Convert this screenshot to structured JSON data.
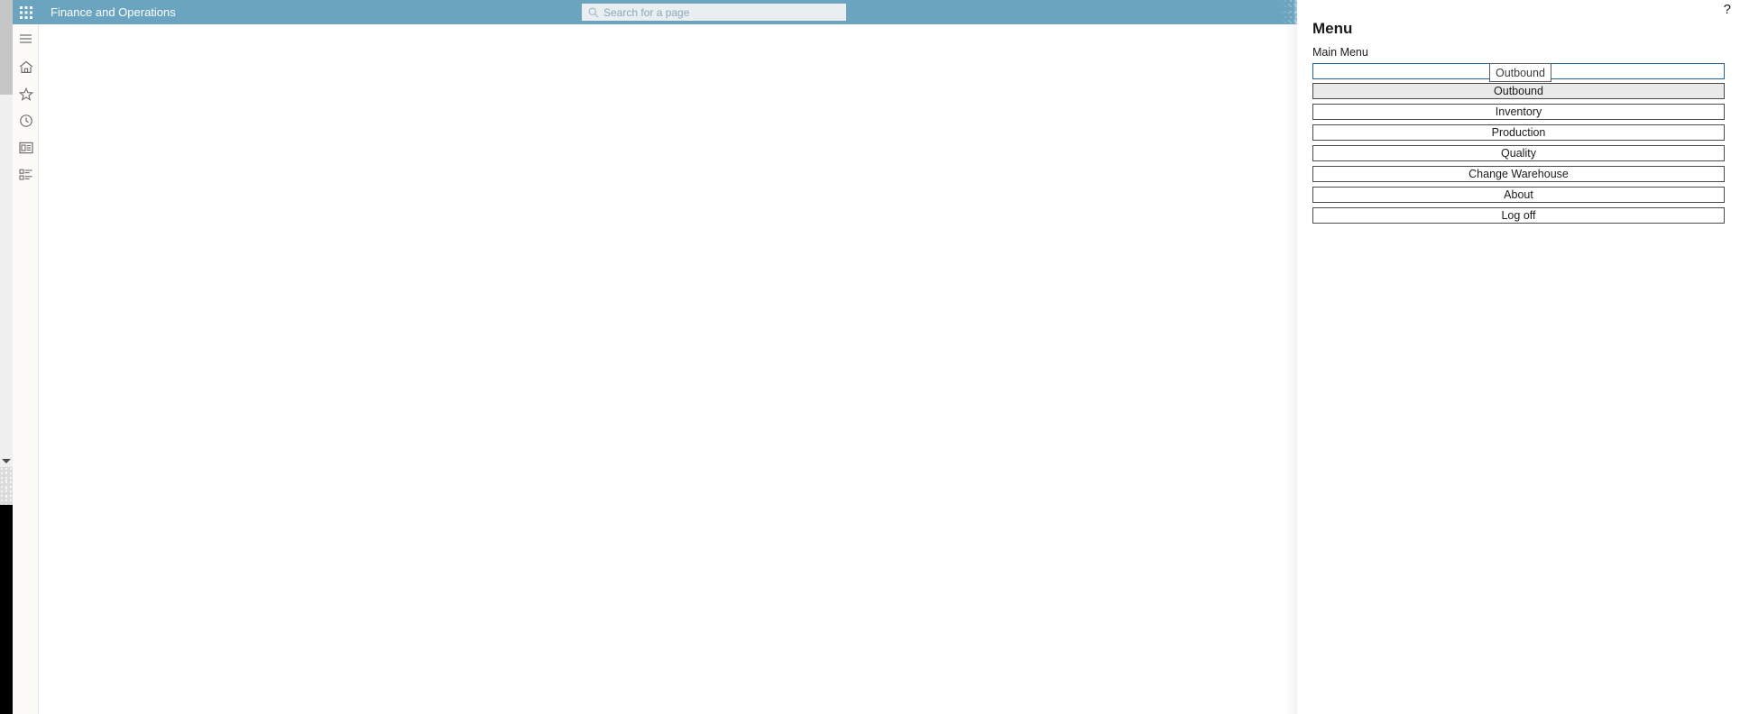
{
  "app": {
    "title": "Finance and Operations",
    "waffle_icon": "app-launcher-icon"
  },
  "search": {
    "placeholder": "Search for a page",
    "value": "",
    "icon": "search-icon"
  },
  "nav_rail": {
    "items": [
      {
        "icon": "hamburger-menu-icon",
        "label": "Expand the navigation pane"
      },
      {
        "icon": "home-icon",
        "label": "Home"
      },
      {
        "icon": "star-icon",
        "label": "Favorites"
      },
      {
        "icon": "clock-icon",
        "label": "Recent"
      },
      {
        "icon": "workspaces-icon",
        "label": "Workspaces"
      },
      {
        "icon": "modules-list-icon",
        "label": "Modules"
      }
    ]
  },
  "side_panel": {
    "help_label": "?",
    "title": "Menu",
    "subtitle": "Main Menu",
    "input": {
      "value": "",
      "placeholder": ""
    },
    "autocomplete": {
      "suggestion": "Outbound"
    },
    "buttons": [
      {
        "label": "Outbound",
        "state": "hovered"
      },
      {
        "label": "Inventory",
        "state": "normal"
      },
      {
        "label": "Production",
        "state": "normal"
      },
      {
        "label": "Quality",
        "state": "normal"
      },
      {
        "label": "Change Warehouse",
        "state": "normal"
      },
      {
        "label": "About",
        "state": "normal"
      },
      {
        "label": "Log off",
        "state": "normal"
      }
    ]
  },
  "colors": {
    "brand_blue": "#6ba4bf",
    "nav_rail_bg": "#fdfbf7",
    "input_focus_border": "#1f6399",
    "button_hover_bg": "#e9e9e9"
  }
}
